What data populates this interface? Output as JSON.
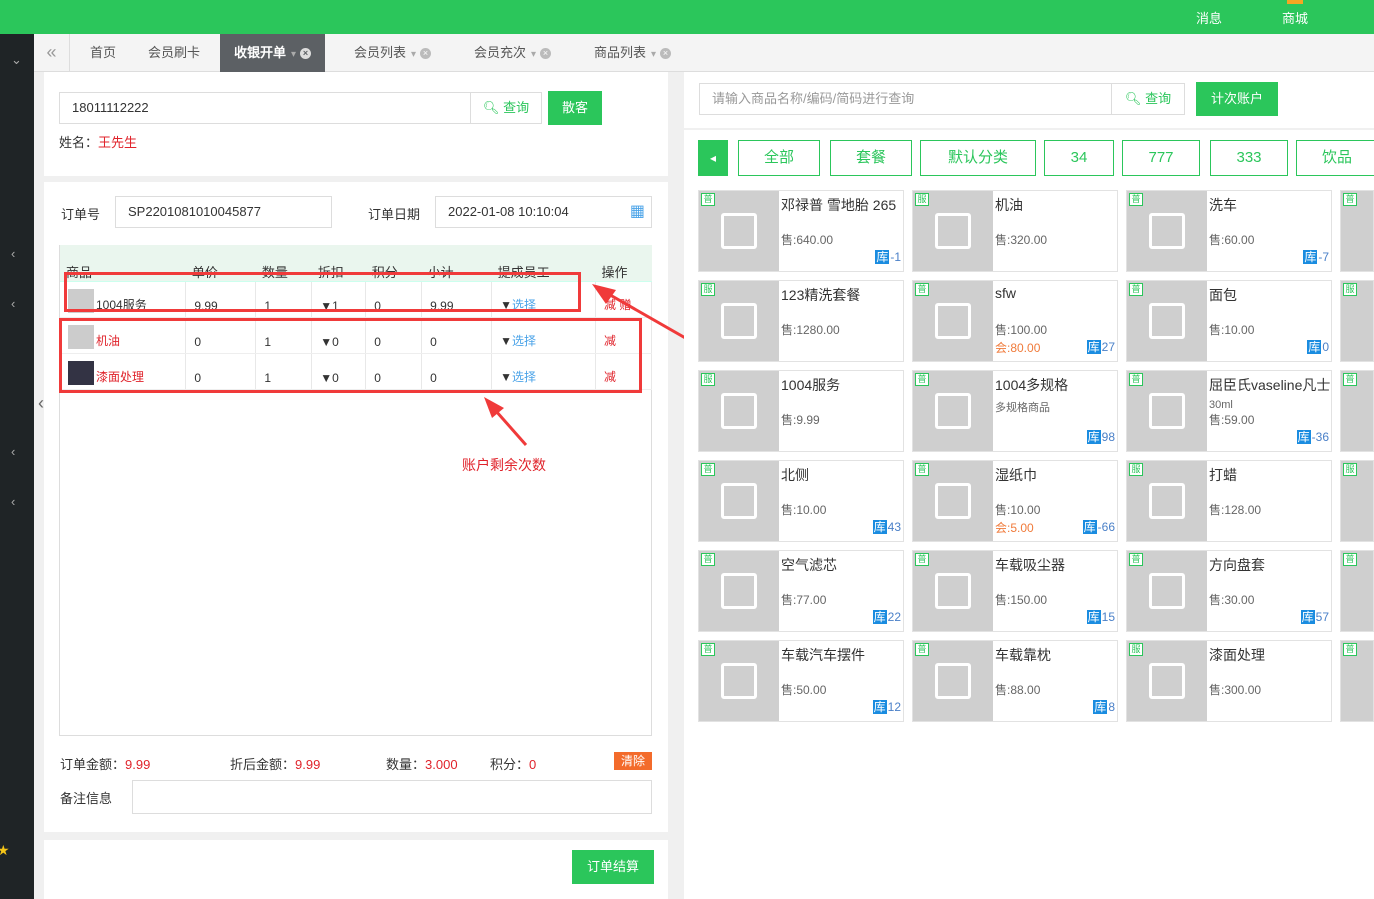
{
  "top_nav": {
    "messages": "消息",
    "mall": "商城"
  },
  "tabs": [
    {
      "label": "首页"
    },
    {
      "label": "会员刷卡"
    },
    {
      "label": "收银开单",
      "active": true
    },
    {
      "label": "会员列表"
    },
    {
      "label": "会员充次"
    },
    {
      "label": "商品列表"
    }
  ],
  "member": {
    "phone": "18011112222",
    "query_label": "查询",
    "walkin_label": "散客",
    "name_label": "姓名：",
    "name": "王先生"
  },
  "order": {
    "no_label": "订单号",
    "no": "SP2201081010045877",
    "date_label": "订单日期",
    "date": "2022-01-08 10:10:04"
  },
  "cart": {
    "headers": [
      "商品",
      "单价",
      "数量",
      "折扣",
      "积分",
      "小计",
      "提成员工",
      "操作"
    ],
    "rows": [
      {
        "name": "1004服务",
        "price": "9.99",
        "qty": "1",
        "discount": "▼1",
        "points": "0",
        "subtotal": "9.99",
        "staff": "选择",
        "op": "减 赠"
      },
      {
        "name": "机油",
        "price": "0",
        "qty": "1",
        "discount": "▼0",
        "points": "0",
        "subtotal": "0",
        "staff": "选择",
        "op": "减"
      },
      {
        "name": "漆面处理",
        "price": "0",
        "qty": "1",
        "discount": "▼0",
        "points": "0",
        "subtotal": "0",
        "staff": "选择",
        "op": "减"
      }
    ],
    "staff_prefix": "▼"
  },
  "annotation": "账户剩余次数",
  "summary": {
    "order_amount_label": "订单金额：",
    "order_amount": "9.99",
    "after_discount_label": "折后金额：",
    "after_discount": "9.99",
    "qty_label": "数量：",
    "qty": "3.000",
    "points_label": "积分：",
    "points": "0",
    "clear_label": "清除",
    "remark_label": "备注信息"
  },
  "checkout_label": "订单结算",
  "search": {
    "placeholder": "请输入商品名称/编码/简码进行查询",
    "query_label": "查询",
    "account_label": "计次账户"
  },
  "categories": [
    "全部",
    "套餐",
    "默认分类",
    "34",
    "777",
    "333",
    "饮品"
  ],
  "products": [
    {
      "tag": "普",
      "name": "邓禄普 雪地胎 265",
      "price": "售:640.00",
      "stock": "-1"
    },
    {
      "tag": "服",
      "name": "机油",
      "price": "售:320.00",
      "stock": ""
    },
    {
      "tag": "普",
      "name": "洗车",
      "price": "售:60.00",
      "stock": "-7"
    },
    {
      "tag": "服",
      "name": "123精洗套餐",
      "price": "售:1280.00",
      "stock": ""
    },
    {
      "tag": "普",
      "name": "sfw",
      "price": "售:100.00",
      "member_price": "会:80.00",
      "stock": "27"
    },
    {
      "tag": "普",
      "name": "面包",
      "price": "售:10.00",
      "stock": "0"
    },
    {
      "tag": "服",
      "name": "1004服务",
      "price": "售:9.99",
      "stock": ""
    },
    {
      "tag": "普",
      "name": "1004多规格",
      "sub": "多规格商品",
      "price": "",
      "stock": "98"
    },
    {
      "tag": "普",
      "name": "屈臣氏vaseline凡士",
      "sub": "30ml",
      "price": "售:59.00",
      "stock": "-36"
    },
    {
      "tag": "普",
      "name": "北侧",
      "price": "售:10.00",
      "stock": "43"
    },
    {
      "tag": "普",
      "name": "湿纸巾",
      "price": "售:10.00",
      "member_price": "会:5.00",
      "stock": "-66"
    },
    {
      "tag": "服",
      "name": "打蜡",
      "price": "售:128.00",
      "stock": ""
    },
    {
      "tag": "普",
      "name": "空气滤芯",
      "price": "售:77.00",
      "stock": "22"
    },
    {
      "tag": "普",
      "name": "车载吸尘器",
      "price": "售:150.00",
      "stock": "15"
    },
    {
      "tag": "普",
      "name": "方向盘套",
      "price": "售:30.00",
      "stock": "57"
    },
    {
      "tag": "普",
      "name": "车载汽车摆件",
      "price": "售:50.00",
      "stock": "12"
    },
    {
      "tag": "普",
      "name": "车载靠枕",
      "price": "售:88.00",
      "stock": "8"
    },
    {
      "tag": "服",
      "name": "漆面处理",
      "price": "售:300.00",
      "stock": ""
    }
  ],
  "edge_tags": [
    "普",
    "服",
    "普",
    "服",
    "普",
    "普"
  ],
  "stock_label": "库",
  "colors": {
    "primary": "#2bc65b",
    "sidebar": "#1f2426",
    "alert": "#e0232b",
    "clear": "#f36b2b"
  }
}
